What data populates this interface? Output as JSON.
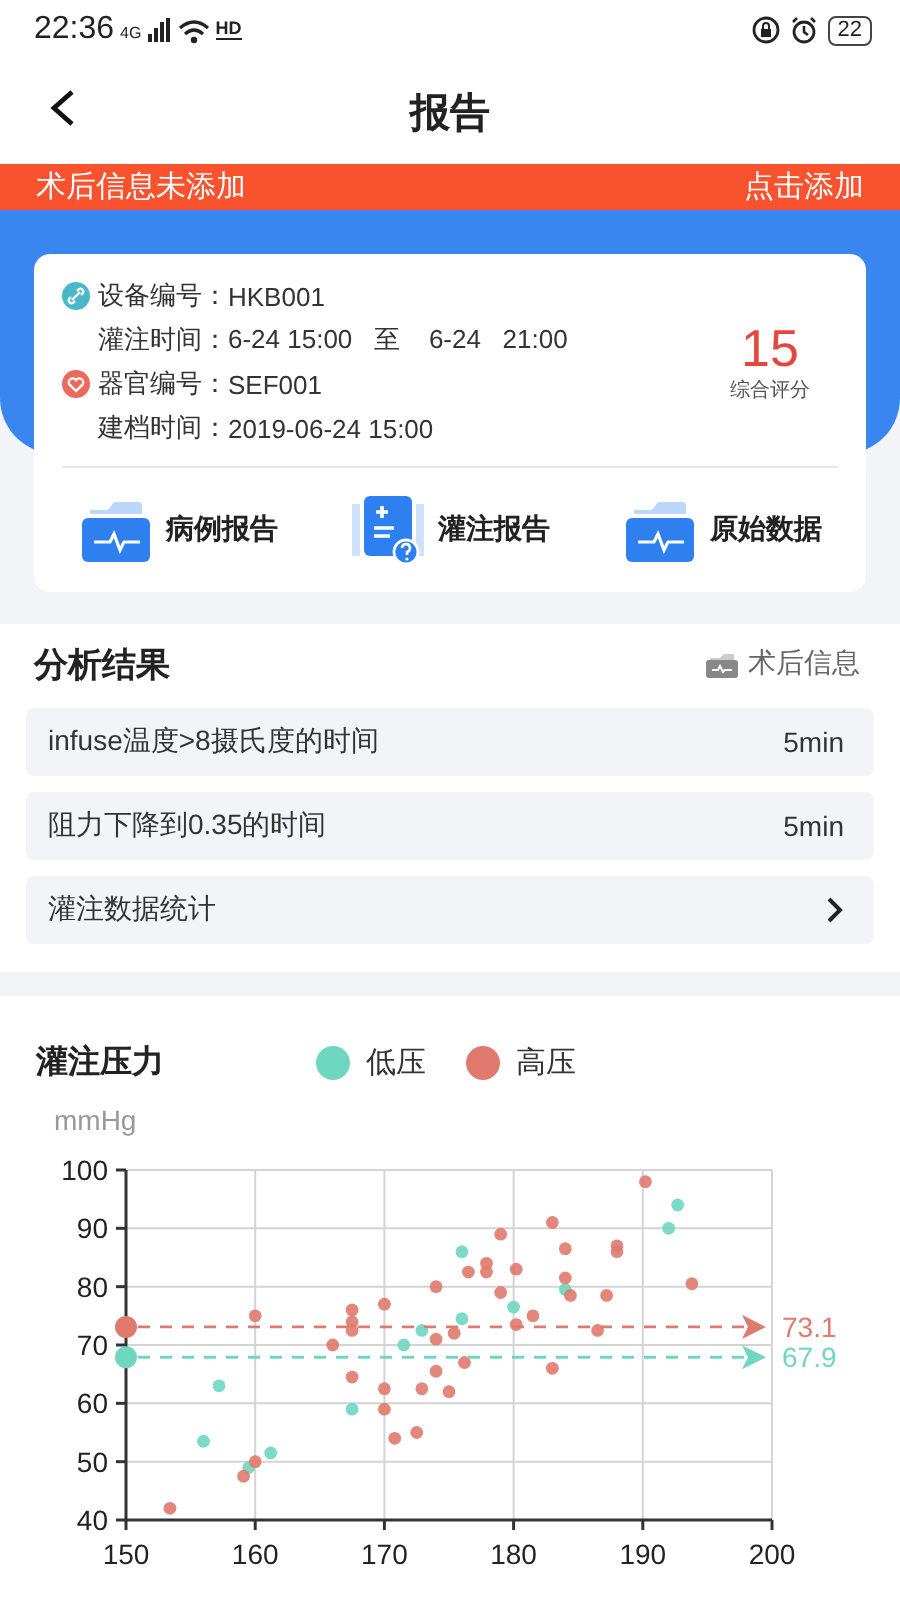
{
  "status_bar": {
    "time": "22:36",
    "network": "4G",
    "hd": "HD",
    "battery": "22"
  },
  "header": {
    "title": "报告"
  },
  "banner": {
    "message": "术后信息未添加",
    "action": "点击添加"
  },
  "summary": {
    "fields": [
      {
        "label": "设备编号：",
        "value": "HKB001",
        "kind": "device"
      },
      {
        "label": "灌注时间：",
        "value": "6-24 15:00   至    6-24   21:00",
        "kind": "plain"
      },
      {
        "label": "器官编号：",
        "value": "SEF001",
        "kind": "organ"
      },
      {
        "label": "建档时间：",
        "value": "2019-06-24 15:00",
        "kind": "plain"
      }
    ],
    "score": "15",
    "score_label": "综合评分",
    "actions": [
      {
        "label": "病例报告",
        "kind": "folder"
      },
      {
        "label": "灌注报告",
        "kind": "calculator"
      },
      {
        "label": "原始数据",
        "kind": "folder"
      }
    ]
  },
  "analysis": {
    "title": "分析结果",
    "link": "术后信息",
    "rows": [
      {
        "label": "infuse温度>8摄氏度的时间",
        "value": "5min",
        "kind": "value"
      },
      {
        "label": "阻力下降到0.35的时间",
        "value": "5min",
        "kind": "value"
      },
      {
        "label": "灌注数据统计",
        "kind": "link"
      }
    ]
  },
  "chart": {
    "title": "灌注压力",
    "unit": "mmHg",
    "chart_data": {
      "type": "scatter",
      "xlim": [
        150,
        200
      ],
      "ylim": [
        40,
        100
      ],
      "xticks": [
        150,
        160,
        170,
        180,
        190,
        200
      ],
      "yticks": [
        40,
        50,
        60,
        70,
        80,
        90,
        100
      ],
      "series": [
        {
          "name": "低压",
          "color": "#6fd6c0",
          "x": [
            156,
            157.2,
            159.5,
            161.2,
            167.5,
            171.5,
            172.9,
            176,
            176,
            180,
            184,
            192,
            192.7
          ],
          "values": [
            53.5,
            63,
            49,
            51.5,
            59,
            70,
            72.5,
            86,
            74.5,
            76.5,
            79.5,
            90,
            94
          ]
        },
        {
          "name": "高压",
          "color": "#e07a6e",
          "x": [
            153.4,
            159.1,
            160,
            160,
            166,
            167.5,
            167.5,
            167.5,
            167.5,
            170,
            170,
            170,
            170.8,
            172.5,
            172.9,
            174,
            174,
            174,
            175,
            175.4,
            176.2,
            176.5,
            177.9,
            177.9,
            179,
            179,
            180.2,
            180.2,
            181.5,
            183,
            183,
            184,
            184,
            184.4,
            186.5,
            187.2,
            188,
            188,
            190.2,
            193.8
          ],
          "values": [
            42,
            47.5,
            50,
            75,
            70,
            76,
            74,
            72.5,
            64.5,
            77,
            62.5,
            59,
            54,
            55,
            62.5,
            80,
            71,
            65.5,
            62,
            72,
            67,
            82.5,
            84,
            82.5,
            89,
            79,
            83,
            73.5,
            75,
            91,
            66,
            86.5,
            81.5,
            78.5,
            72.5,
            78.5,
            87,
            86,
            98,
            80.5
          ]
        }
      ],
      "grid": true,
      "ref_lines": [
        {
          "axis": "y",
          "value": 73.1,
          "label": "73.1",
          "color": "#e07a6e"
        },
        {
          "axis": "y",
          "value": 67.9,
          "label": "67.9",
          "color": "#6fd6c0"
        }
      ]
    }
  }
}
